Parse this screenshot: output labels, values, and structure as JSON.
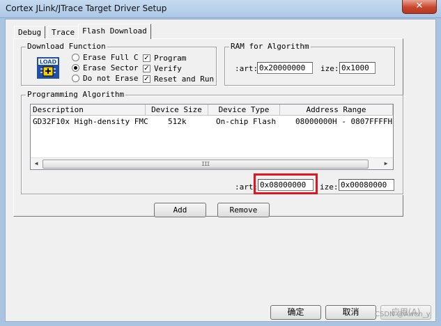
{
  "window": {
    "title": "Cortex JLink/JTrace Target Driver Setup",
    "close_glyph": "✕"
  },
  "tabs": [
    {
      "label": "Debug",
      "active": false
    },
    {
      "label": "Trace",
      "active": false
    },
    {
      "label": "Flash Download",
      "active": true
    }
  ],
  "download_function": {
    "title": "Download Function",
    "icon": "load-flash-icon",
    "icon_text": "LOAD",
    "radios": [
      {
        "label": "Erase Full C",
        "selected": false
      },
      {
        "label": "Erase Sector",
        "selected": true
      },
      {
        "label": "Do not Erase",
        "selected": false
      }
    ],
    "checks": [
      {
        "label": "Program",
        "checked": true
      },
      {
        "label": "Verify",
        "checked": true
      },
      {
        "label": "Reset and Run",
        "checked": true
      }
    ]
  },
  "ram": {
    "title": "RAM for Algorithm",
    "start_label": ":art:",
    "start_value": "0x20000000",
    "size_label": "ize:",
    "size_value": "0x1000"
  },
  "programming": {
    "title": "Programming Algorithm",
    "columns": [
      "Description",
      "Device Size",
      "Device Type",
      "Address Range"
    ],
    "rows": [
      [
        "GD32F10x High-density FMC",
        "512k",
        "On-chip Flash",
        "08000000H - 0807FFFFH"
      ]
    ],
    "scroll_left": "◀",
    "scroll_right": "▶",
    "scroll_grip": "III",
    "start_label": ":art:",
    "start_value": "0x08000000",
    "size_label": "ize:",
    "size_value": "0x00080000",
    "highlight_color": "#e0151d"
  },
  "buttons": {
    "add": "Add",
    "remove": "Remove",
    "ok": "确定",
    "cancel": "取消",
    "apply": "应用(A)"
  },
  "watermark": "CSDN @Awen_y"
}
